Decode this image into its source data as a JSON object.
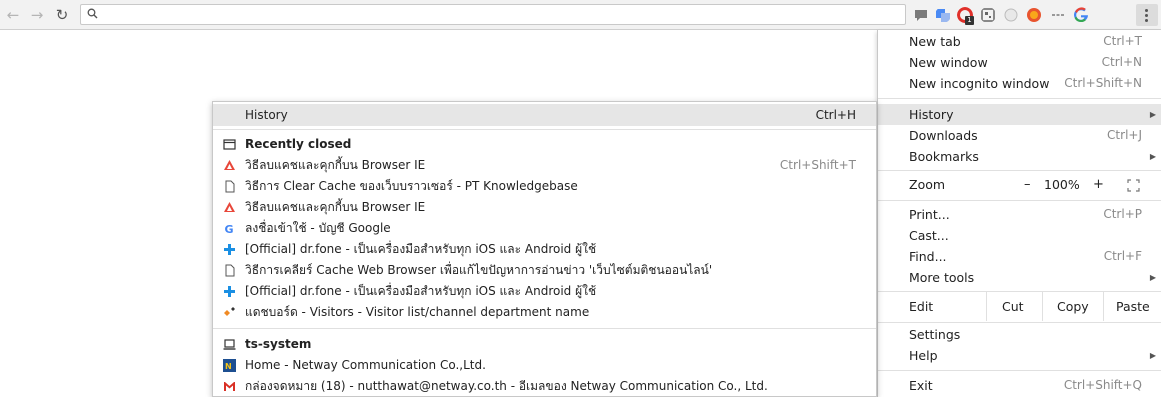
{
  "toolbar": {
    "back_icon": "arrow-left-icon",
    "forward_icon": "arrow-right-icon",
    "reload_icon": "reload-icon",
    "search_icon": "search-icon",
    "extensions": [
      "comment-icon",
      "translate-icon",
      "opera-icon",
      "qr-icon",
      "moon-icon",
      "stop-icon",
      "ellipsis-icon",
      "google-icon"
    ],
    "extension_badge": "1",
    "menu_icon": "more-vert-icon"
  },
  "menu": {
    "new_tab": {
      "label": "New tab",
      "shortcut": "Ctrl+T"
    },
    "new_window": {
      "label": "New window",
      "shortcut": "Ctrl+N"
    },
    "new_incognito": {
      "label": "New incognito window",
      "shortcut": "Ctrl+Shift+N"
    },
    "history": {
      "label": "History"
    },
    "downloads": {
      "label": "Downloads",
      "shortcut": "Ctrl+J"
    },
    "bookmarks": {
      "label": "Bookmarks"
    },
    "zoom": {
      "label": "Zoom",
      "minus": "–",
      "level": "100%",
      "plus": "+"
    },
    "print": {
      "label": "Print...",
      "shortcut": "Ctrl+P"
    },
    "cast": {
      "label": "Cast..."
    },
    "find": {
      "label": "Find...",
      "shortcut": "Ctrl+F"
    },
    "more_tools": {
      "label": "More tools"
    },
    "edit": {
      "label": "Edit",
      "cut": "Cut",
      "copy": "Copy",
      "paste": "Paste"
    },
    "settings": {
      "label": "Settings"
    },
    "help": {
      "label": "Help"
    },
    "exit": {
      "label": "Exit",
      "shortcut": "Ctrl+Shift+Q"
    }
  },
  "history": {
    "title": "History",
    "shortcut": "Ctrl+H",
    "recently_closed_label": "Recently closed",
    "recently_closed": [
      {
        "title": "วิธีลบแคชและคุกกี้บน Browser IE",
        "shortcut": "Ctrl+Shift+T",
        "icon": "pt-icon"
      },
      {
        "title": "วิธีการ Clear Cache ของเว็บบราวเซอร์ - PT Knowledgebase",
        "icon": "page-icon"
      },
      {
        "title": "วิธีลบแคชและคุกกี้บน Browser IE",
        "icon": "pt-icon"
      },
      {
        "title": "ลงชื่อเข้าใช้ - บัญชี Google",
        "icon": "google-icon"
      },
      {
        "title": "[Official] dr.fone - เป็นเครื่องมือสำหรับทุก iOS และ Android ผู้ใช้",
        "icon": "drfone-icon"
      },
      {
        "title": "วิธีการเคลียร์ Cache Web Browser เพื่อแก้ไขปัญหาการอ่านข่าว 'เว็บไซต์มติชนออนไลน์'",
        "icon": "page-icon"
      },
      {
        "title": "[Official] dr.fone - เป็นเครื่องมือสำหรับทุก iOS และ Android ผู้ใช้",
        "icon": "drfone-icon"
      },
      {
        "title": "แดชบอร์ด - Visitors - Visitor list/channel department name",
        "icon": "dashboard-icon"
      }
    ],
    "device_label": "ts-system",
    "device_items": [
      {
        "title": "Home - Netway Communication Co.,Ltd.",
        "icon": "netway-icon"
      },
      {
        "title": "กล่องจดหมาย (18) - nutthawat@netway.co.th - อีเมลของ Netway Communication Co., Ltd.",
        "icon": "gmail-icon"
      }
    ]
  },
  "colors": {
    "toolbar_bg": "#f2f2f2",
    "menu_highlight": "#e6e6e6",
    "shortcut_gray": "#8a8a8a"
  }
}
